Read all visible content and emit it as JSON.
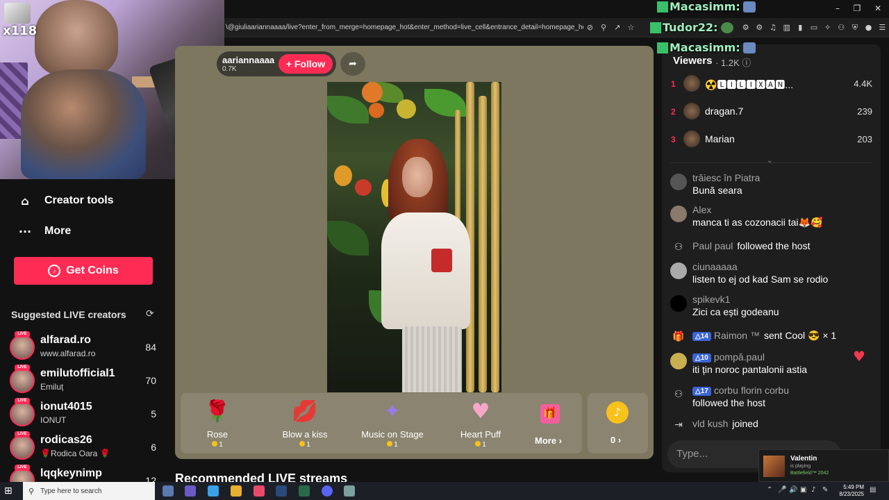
{
  "browser": {
    "url": "\\@giuliaariannaaaa/live?enter_from_merge=homepage_hot&enter_method=live_cell&entrance_detail=homepage_hot_live_cell...",
    "window_controls": {
      "minimize": "–",
      "maximize": "❐",
      "close": "✕"
    }
  },
  "webcam": {
    "tag": "x118"
  },
  "overlay_chat": [
    {
      "user": "Macasimm:"
    },
    {
      "user": "Tudor22:"
    },
    {
      "user": "Macasimm:"
    }
  ],
  "nav": {
    "creator_tools": "Creator tools",
    "more": "More",
    "get_coins": "Get Coins"
  },
  "suggested": {
    "title": "Suggested LIVE creators",
    "live_badge": "LIVE",
    "items": [
      {
        "name": "alfarad.ro",
        "sub": "www.alfarad.ro",
        "count": "84"
      },
      {
        "name": "emilutofficial1",
        "sub": "Emiluț",
        "count": "70"
      },
      {
        "name": "ionut4015",
        "sub": "IONUT",
        "count": "5"
      },
      {
        "name": "rodicas26",
        "sub": "🌹Rodica Oara 🌹",
        "count": "6"
      },
      {
        "name": "lqqkeynimp",
        "sub": "",
        "count": "12"
      }
    ]
  },
  "host": {
    "name": "aariannaaaa",
    "likes": "0.7K",
    "follow_label": "+ Follow"
  },
  "gifts": [
    {
      "name": "Rose",
      "price": "1",
      "icon": "rose-icon",
      "glyph": "🌹",
      "color": "#e8334a"
    },
    {
      "name": "Blow a kiss",
      "price": "1",
      "icon": "kiss-icon",
      "glyph": "💋",
      "color": "#e83a52"
    },
    {
      "name": "Music on Stage",
      "price": "1",
      "icon": "music-star-icon",
      "glyph": "✦",
      "color": "#9a7ae8"
    },
    {
      "name": "Heart Puff",
      "price": "1",
      "icon": "heart-puff-icon",
      "glyph": "♥",
      "color": "#f6a7c8"
    }
  ],
  "gift_more": "More ›",
  "wallet": {
    "value": "0 ›"
  },
  "recommended_title": "Recommended LIVE streams",
  "viewers": {
    "title": "Viewers",
    "count": "· 1.2K",
    "top": [
      {
        "rank": "1",
        "name": "☢️🅻🅸🅻🅸🆇🅰🅽...",
        "score": "4.4K"
      },
      {
        "rank": "2",
        "name": "dragan.7",
        "score": "239"
      },
      {
        "rank": "3",
        "name": "Marian",
        "score": "203"
      }
    ]
  },
  "chat": [
    {
      "user": "trăiesc în Piatra",
      "text": "Bună seara"
    },
    {
      "user": "Alex",
      "text": "manca ti as cozonacii tai🦊🥰"
    },
    {
      "user": "Paul paul",
      "action": "followed the host"
    },
    {
      "user": "ciunaaaaa",
      "text": "listen to ej od kad Sam se rodio"
    },
    {
      "user": "spikevk1",
      "text": "Zici ca ești godeanu"
    },
    {
      "badge": "14",
      "user": "Raimon ™",
      "action": "sent Cool 😎 × 1"
    },
    {
      "badge": "10",
      "user": "pompă.paul",
      "text": "iti țin noroc pantalonii astia"
    },
    {
      "badge": "17",
      "user": "corbu florin corbu",
      "text": "followed the host"
    },
    {
      "user": "vld kush",
      "action": "joined"
    }
  ],
  "chat_input": {
    "placeholder": "Type..."
  },
  "game_popup": {
    "name": "Valentin",
    "status": "is playing",
    "game": "Battlefield™ 2042"
  },
  "taskbar": {
    "search_placeholder": "Type here to search",
    "time": "5:49 PM",
    "date": "8/23/2025"
  }
}
